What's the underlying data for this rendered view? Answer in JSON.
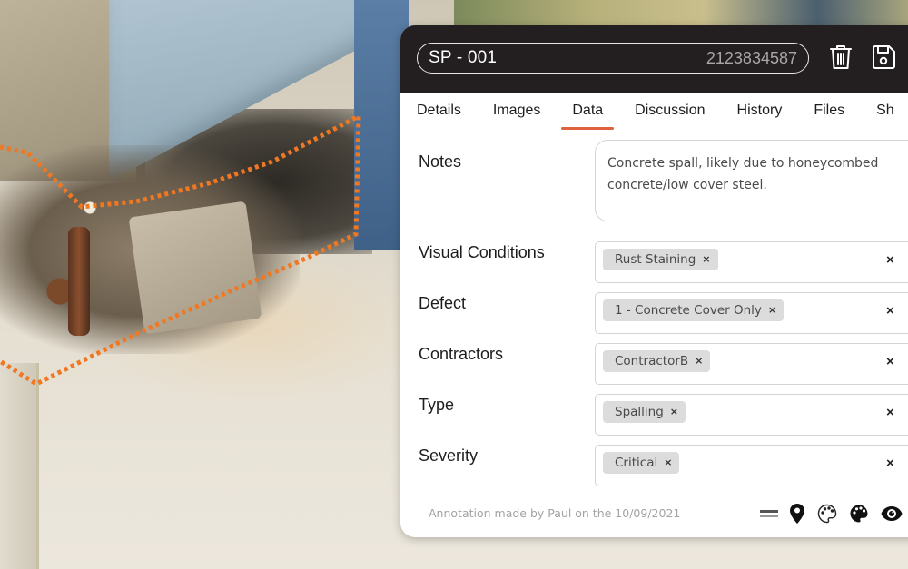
{
  "colors": {
    "accent": "#e0623c",
    "annotation_outline": "#f07822",
    "header_bg": "#231f20"
  },
  "record": {
    "code": "SP - 001",
    "number": "2123834587",
    "delete_icon": "trash-icon",
    "save_icon": "floppy-disk-icon"
  },
  "tabs": [
    {
      "label": "Details",
      "active": false
    },
    {
      "label": "Images",
      "active": false
    },
    {
      "label": "Data",
      "active": true
    },
    {
      "label": "Discussion",
      "active": false
    },
    {
      "label": "History",
      "active": false
    },
    {
      "label": "Files",
      "active": false
    },
    {
      "label": "Sh",
      "active": false
    }
  ],
  "form": {
    "notes": {
      "label": "Notes",
      "value": "Concrete spall, likely due to honeycombed concrete/low cover steel."
    },
    "fields": [
      {
        "label": "Visual Conditions",
        "chip": "Rust Staining"
      },
      {
        "label": "Defect",
        "chip": "1 - Concrete Cover Only"
      },
      {
        "label": "Contractors",
        "chip": "ContractorB"
      },
      {
        "label": "Type",
        "chip": "Spalling"
      },
      {
        "label": "Severity",
        "chip": "Critical"
      }
    ],
    "chip_remove_glyph": "×",
    "clear_glyph": "×"
  },
  "footer": {
    "credit": "Annotation made by Paul on the 10/09/2021",
    "icons": [
      "drag-handle-icon",
      "map-pin-icon",
      "palette-outline-icon",
      "palette-filled-icon",
      "eye-icon"
    ]
  }
}
